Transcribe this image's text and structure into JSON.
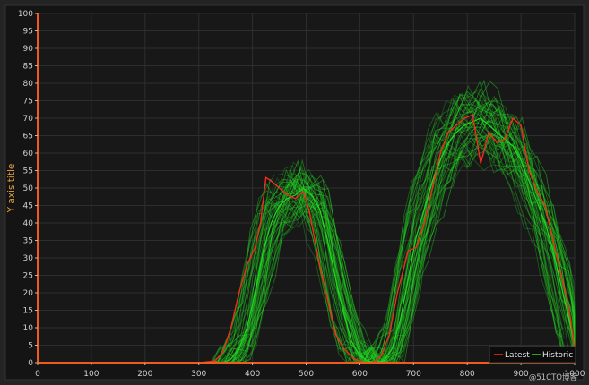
{
  "chart_data": {
    "type": "line",
    "title": "",
    "xlabel": "",
    "ylabel": "Y axis title",
    "xlim": [
      0,
      1000
    ],
    "ylim": [
      0,
      100
    ],
    "x_ticks": [
      0,
      100,
      200,
      300,
      400,
      500,
      600,
      700,
      800,
      900,
      1000
    ],
    "y_ticks": [
      0,
      5,
      10,
      15,
      20,
      25,
      30,
      35,
      40,
      45,
      50,
      55,
      60,
      65,
      70,
      75,
      80,
      85,
      90,
      95,
      100
    ],
    "grid": true,
    "legend_position": "bottom-right",
    "series": [
      {
        "name": "Latest",
        "color": "#ff2a1a",
        "x": [
          0,
          100,
          200,
          300,
          330,
          345,
          360,
          375,
          390,
          405,
          415,
          425,
          435,
          450,
          465,
          480,
          495,
          505,
          515,
          525,
          540,
          555,
          570,
          590,
          610,
          625,
          640,
          655,
          670,
          690,
          705,
          720,
          735,
          750,
          765,
          780,
          795,
          810,
          825,
          840,
          855,
          870,
          885,
          900,
          915,
          930,
          945,
          960,
          975,
          990,
          1000
        ],
        "y": [
          0,
          0,
          0,
          0,
          0.5,
          3,
          10,
          20,
          28,
          33,
          40,
          53,
          52,
          50,
          48,
          47,
          49,
          44,
          36,
          28,
          18,
          8,
          4,
          1,
          0,
          0,
          2,
          8,
          20,
          32,
          33,
          40,
          50,
          60,
          66,
          68,
          70,
          71,
          57,
          66,
          63,
          64,
          70,
          68,
          55,
          49,
          45,
          35,
          25,
          15,
          4
        ]
      },
      {
        "name": "Historic",
        "color": "#22d922",
        "x": [
          0,
          100,
          200,
          300,
          330,
          345,
          360,
          375,
          390,
          405,
          420,
          435,
          450,
          465,
          480,
          495,
          510,
          525,
          540,
          555,
          570,
          585,
          600,
          615,
          630,
          645,
          660,
          675,
          690,
          705,
          720,
          735,
          750,
          765,
          780,
          795,
          810,
          825,
          840,
          855,
          870,
          885,
          900,
          915,
          930,
          945,
          960,
          975,
          990,
          1000
        ],
        "y": [
          0,
          0,
          0,
          0,
          0,
          0,
          1,
          4,
          10,
          20,
          32,
          40,
          45,
          47,
          48,
          50,
          48,
          44,
          35,
          24,
          14,
          6,
          2,
          0.5,
          0,
          0.5,
          4,
          12,
          24,
          36,
          44,
          52,
          58,
          63,
          66,
          68,
          69,
          70,
          68,
          66,
          64,
          62,
          58,
          52,
          46,
          40,
          32,
          22,
          12,
          5
        ]
      }
    ]
  },
  "watermark": "@51CTO博客"
}
